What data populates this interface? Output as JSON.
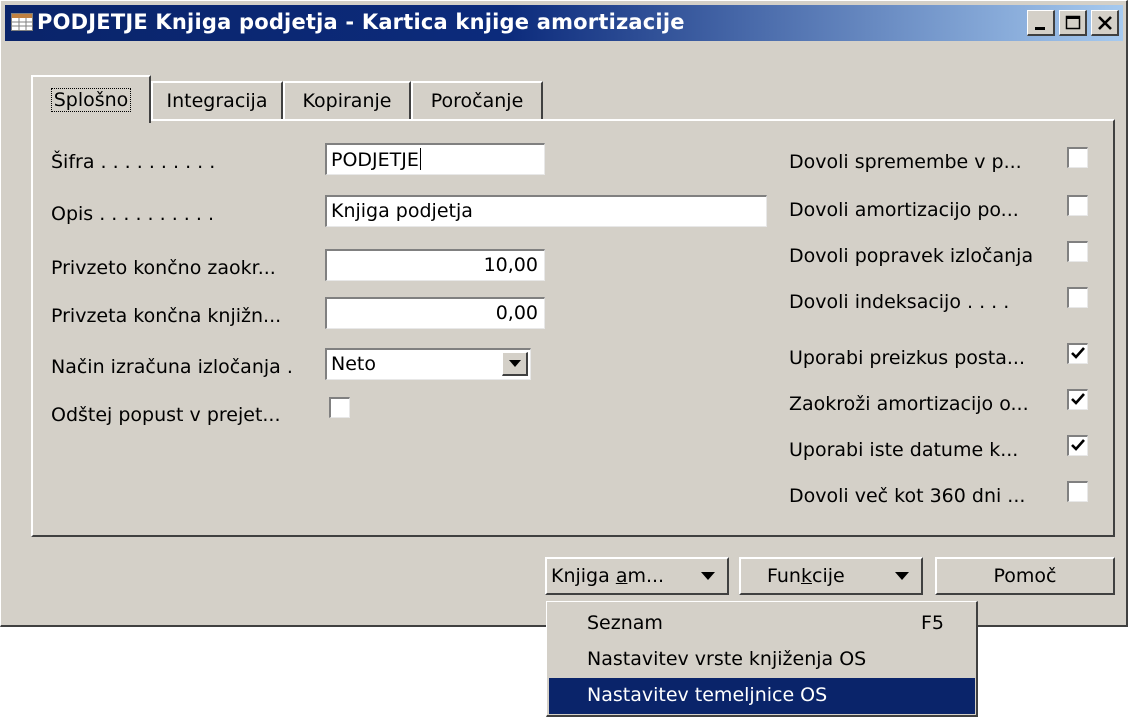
{
  "window": {
    "title": "PODJETJE Knjiga podjetja - Kartica knjige amortizacije"
  },
  "tabs": [
    {
      "label": "Splošno",
      "active": true
    },
    {
      "label": "Integracija",
      "active": false
    },
    {
      "label": "Kopiranje",
      "active": false
    },
    {
      "label": "Poročanje",
      "active": false
    }
  ],
  "fields": {
    "sifra": {
      "label": "Šifra . . . . . . . . . .",
      "value": "PODJETJE"
    },
    "opis": {
      "label": "Opis . . . . . . . . . .",
      "value": "Knjiga podjetja"
    },
    "privzeto_koncno": {
      "label": "Privzeto končno zaokr...",
      "value": "10,00"
    },
    "privzeta_knjizna": {
      "label": "Privzeta končna knjižn...",
      "value": "0,00"
    },
    "nacin_izracuna": {
      "label": "Način izračuna izločanja .",
      "value": "Neto"
    },
    "odstej_popust": {
      "label": "Odštej popust v prejet...",
      "checked": false
    }
  },
  "right_checkboxes": [
    {
      "label": "Dovoli spremembe v p...",
      "checked": false
    },
    {
      "label": "Dovoli amortizacijo po...",
      "checked": false
    },
    {
      "label": "Dovoli popravek izločanja",
      "checked": false
    },
    {
      "label": "Dovoli indeksacijo . . . .",
      "checked": false
    },
    {
      "label": "Uporabi preizkus posta...",
      "checked": true
    },
    {
      "label": "Zaokroži amortizacijo o...",
      "checked": true
    },
    {
      "label": "Uporabi iste datume k...",
      "checked": true
    },
    {
      "label": "Dovoli več kot 360 dni ...",
      "checked": false
    }
  ],
  "buttons": {
    "knjiga": {
      "pre": "Knjiga ",
      "underline": "a",
      "post": "m..."
    },
    "funkcije": {
      "pre": "Fun",
      "underline": "k",
      "post": "cije"
    },
    "pomoc": {
      "label": "Pomoč"
    }
  },
  "menu": {
    "items": [
      {
        "label": "Seznam",
        "shortcut": "F5",
        "selected": false
      },
      {
        "label": "Nastavitev vrste knjiženja OS",
        "shortcut": "",
        "selected": false
      },
      {
        "label": "Nastavitev temeljnice OS",
        "shortcut": "",
        "selected": true
      }
    ]
  },
  "colors": {
    "titlebar": "#0a246a",
    "face": "#d4d0c8",
    "selection": "#0a246a"
  }
}
